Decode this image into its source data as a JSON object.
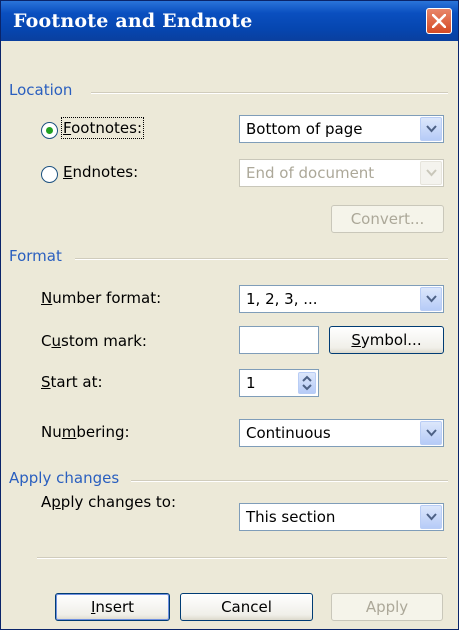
{
  "window": {
    "title": "Footnote and Endnote"
  },
  "location": {
    "section_label": "Location",
    "footnotes": {
      "label": "Footnotes:",
      "value": "Bottom of page",
      "selected": true
    },
    "endnotes": {
      "label": "Endnotes:",
      "value": "End of document",
      "selected": false
    },
    "convert_label": "Convert..."
  },
  "format": {
    "section_label": "Format",
    "number_format": {
      "label": "Number format:",
      "value": "1, 2, 3, ..."
    },
    "custom_mark": {
      "label": "Custom mark:",
      "value": ""
    },
    "symbol_label": "Symbol...",
    "start_at": {
      "label": "Start at:",
      "value": "1"
    },
    "numbering": {
      "label": "Numbering:",
      "value": "Continuous"
    }
  },
  "apply": {
    "section_label": "Apply changes",
    "apply_to": {
      "label": "Apply changes to:",
      "value": "This section"
    }
  },
  "buttons": {
    "insert": "Insert",
    "cancel": "Cancel",
    "apply": "Apply"
  },
  "colors": {
    "section_title": "#2a5fbf",
    "titlebar": "#0a4fc0",
    "close": "#d54a25"
  },
  "icons": {
    "close": "close-icon",
    "dropdown": "chevron-down-icon",
    "spin": "spin-arrows-icon"
  }
}
